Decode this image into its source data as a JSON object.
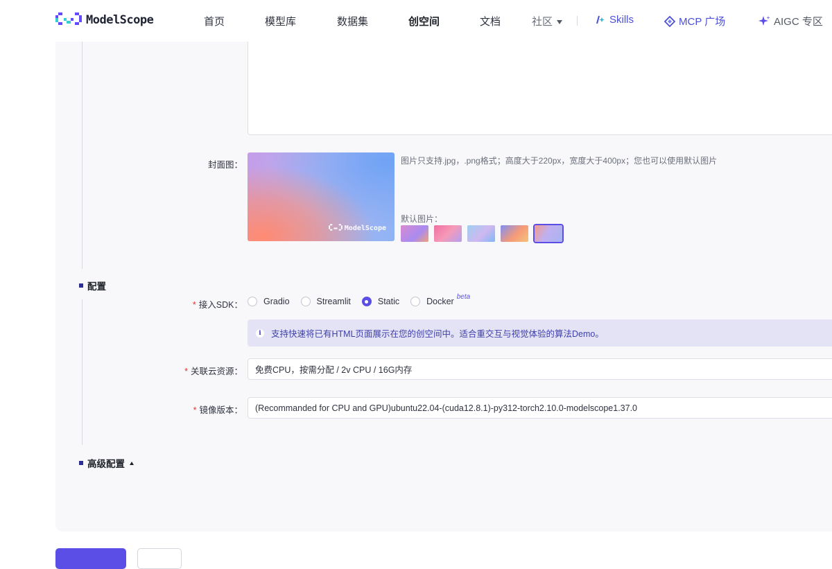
{
  "nav": {
    "brand": "ModelScope",
    "items": [
      "首页",
      "模型库",
      "数据集",
      "创空间",
      "文档",
      "社区"
    ],
    "active": "创空间",
    "links": [
      "Skills",
      "MCP 广场",
      "AIGC 专区"
    ]
  },
  "form": {
    "cover": {
      "label": "封面图：",
      "hint": "图片只支持.jpg，.png格式；高度大于220px，宽度大于400px；您也可以使用默认图片",
      "default_label": "默认图片：",
      "watermark": "ModelScope",
      "thumb_colors": [
        "#d88bd0",
        "#f06fa0",
        "#9fcff0",
        "#f59a78",
        "#a8b4f2"
      ],
      "selected_thumb": 5
    },
    "config": {
      "title": "配置",
      "sdk_label": "接入SDK：",
      "sdk_options": [
        "Gradio",
        "Streamlit",
        "Static",
        "Docker"
      ],
      "sdk_selected": "Static",
      "docker_badge": "beta",
      "info": "支持快速将已有HTML页面展示在您的创空间中。适合重交互与视觉体验的算法Demo。",
      "resource_label": "关联云资源：",
      "resource_value": "免费CPU，按需分配 / 2v CPU / 16G内存",
      "image_label": "镜像版本：",
      "image_value": "(Recommanded for CPU and GPU)ubuntu22.04-(cuda12.8.1)-py312-torch2.10.0-modelscope1.37.0"
    },
    "advanced": {
      "title": "高级配置"
    }
  },
  "colors": {
    "accent": "#5b4ee6",
    "required": "#e0312f",
    "info_bg": "#e4e3f6"
  }
}
